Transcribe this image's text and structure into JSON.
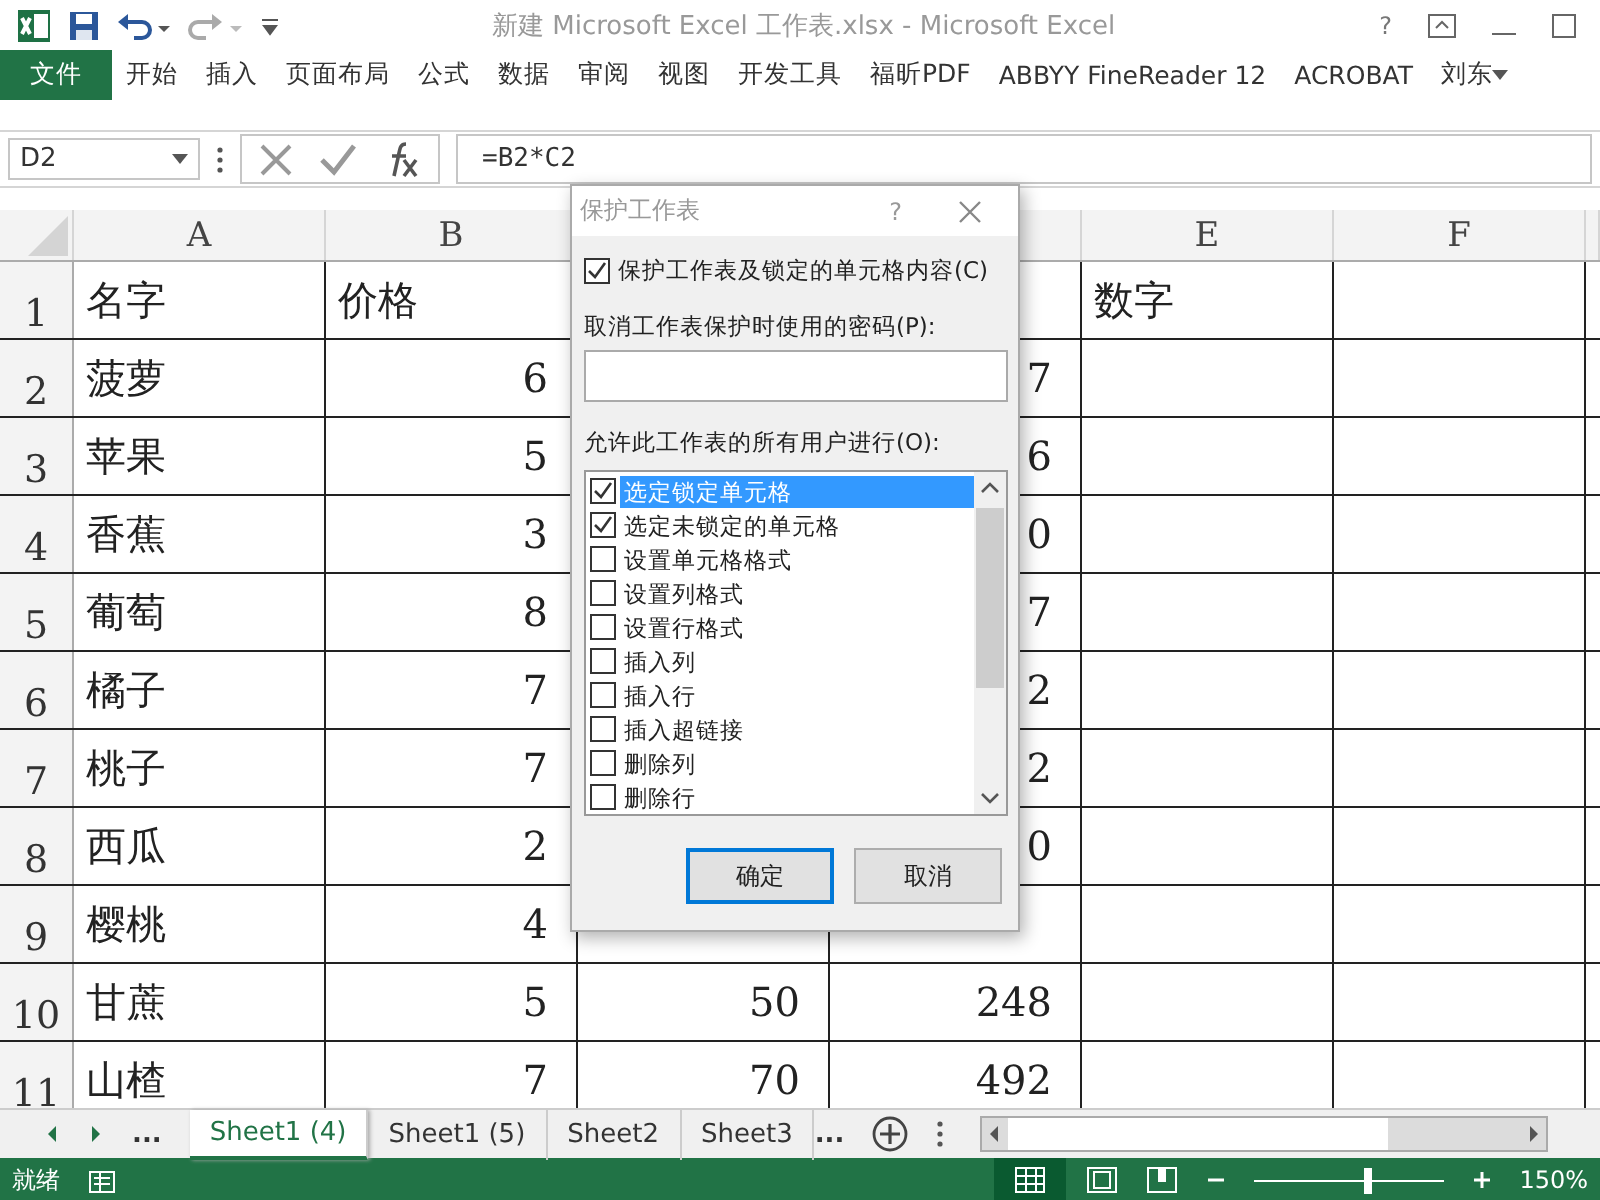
{
  "window": {
    "title": "新建 Microsoft Excel 工作表.xlsx - Microsoft Excel",
    "help": "?"
  },
  "ribbon": {
    "file_tab": "文件",
    "tabs": [
      "开始",
      "插入",
      "页面布局",
      "公式",
      "数据",
      "审阅",
      "视图",
      "开发工具",
      "福昕PDF",
      "ABBYY FineReader 12",
      "ACROBAT"
    ],
    "user": "刘东"
  },
  "formula_bar": {
    "name_box": "D2",
    "formula": "=B2*C2"
  },
  "sheet": {
    "columns": [
      {
        "label": "A"
      },
      {
        "label": "B"
      },
      {},
      {},
      {
        "label": "E"
      },
      {
        "label": "F"
      }
    ],
    "rows": [
      {
        "number": "1",
        "cells": [
          "名字",
          "价格",
          null,
          null,
          "数字",
          null
        ]
      },
      {
        "number": "2",
        "cells": [
          "菠萝",
          "6",
          null,
          "7",
          null,
          null
        ]
      },
      {
        "number": "3",
        "cells": [
          "苹果",
          "5",
          null,
          "6",
          null,
          null
        ]
      },
      {
        "number": "4",
        "cells": [
          "香蕉",
          "3",
          null,
          "0",
          null,
          null
        ]
      },
      {
        "number": "5",
        "cells": [
          "葡萄",
          "8",
          null,
          "7",
          null,
          null
        ]
      },
      {
        "number": "6",
        "cells": [
          "橘子",
          "7",
          null,
          "2",
          null,
          null
        ]
      },
      {
        "number": "7",
        "cells": [
          "桃子",
          "7",
          null,
          "2",
          null,
          null
        ]
      },
      {
        "number": "8",
        "cells": [
          "西瓜",
          "2",
          null,
          "0",
          null,
          null
        ]
      },
      {
        "number": "9",
        "cells": [
          "樱桃",
          "4",
          null,
          null,
          null,
          null
        ]
      },
      {
        "number": "10",
        "cells": [
          "甘蔗",
          "5",
          "50",
          "248",
          null,
          null
        ]
      },
      {
        "number": "11",
        "cells": [
          "山楂",
          "7",
          "70",
          "492",
          null,
          null
        ]
      }
    ]
  },
  "dialog": {
    "title": "保护工作表",
    "help": "?",
    "protect": {
      "label": "保护工作表及锁定的单元格内容(C)",
      "checked": true
    },
    "password_label": "取消工作表保护时使用的密码(P):",
    "allow_label": "允许此工作表的所有用户进行(O):",
    "options": [
      {
        "label": "选定锁定单元格",
        "checked": true,
        "selected": true
      },
      {
        "label": "选定未锁定的单元格",
        "checked": true,
        "selected": false
      },
      {
        "label": "设置单元格格式",
        "checked": false,
        "selected": false
      },
      {
        "label": "设置列格式",
        "checked": false,
        "selected": false
      },
      {
        "label": "设置行格式",
        "checked": false,
        "selected": false
      },
      {
        "label": "插入列",
        "checked": false,
        "selected": false
      },
      {
        "label": "插入行",
        "checked": false,
        "selected": false
      },
      {
        "label": "插入超链接",
        "checked": false,
        "selected": false
      },
      {
        "label": "删除列",
        "checked": false,
        "selected": false
      },
      {
        "label": "删除行",
        "checked": false,
        "selected": false
      }
    ],
    "buttons": [
      {
        "label": "确定",
        "default": true
      },
      {
        "label": "取消",
        "default": false
      }
    ]
  },
  "sheet_tabs": {
    "more_left": "...",
    "tabs": [
      {
        "label": "Sheet1 (4)",
        "selected": true
      },
      {
        "label": "Sheet1 (5)",
        "selected": false
      },
      {
        "label": "Sheet2",
        "selected": false
      },
      {
        "label": "Sheet3",
        "selected": false
      }
    ],
    "more_right": "..."
  },
  "status_bar": {
    "status": "就绪",
    "zoom": {
      "level": 0.6,
      "reading": "150%"
    }
  }
}
